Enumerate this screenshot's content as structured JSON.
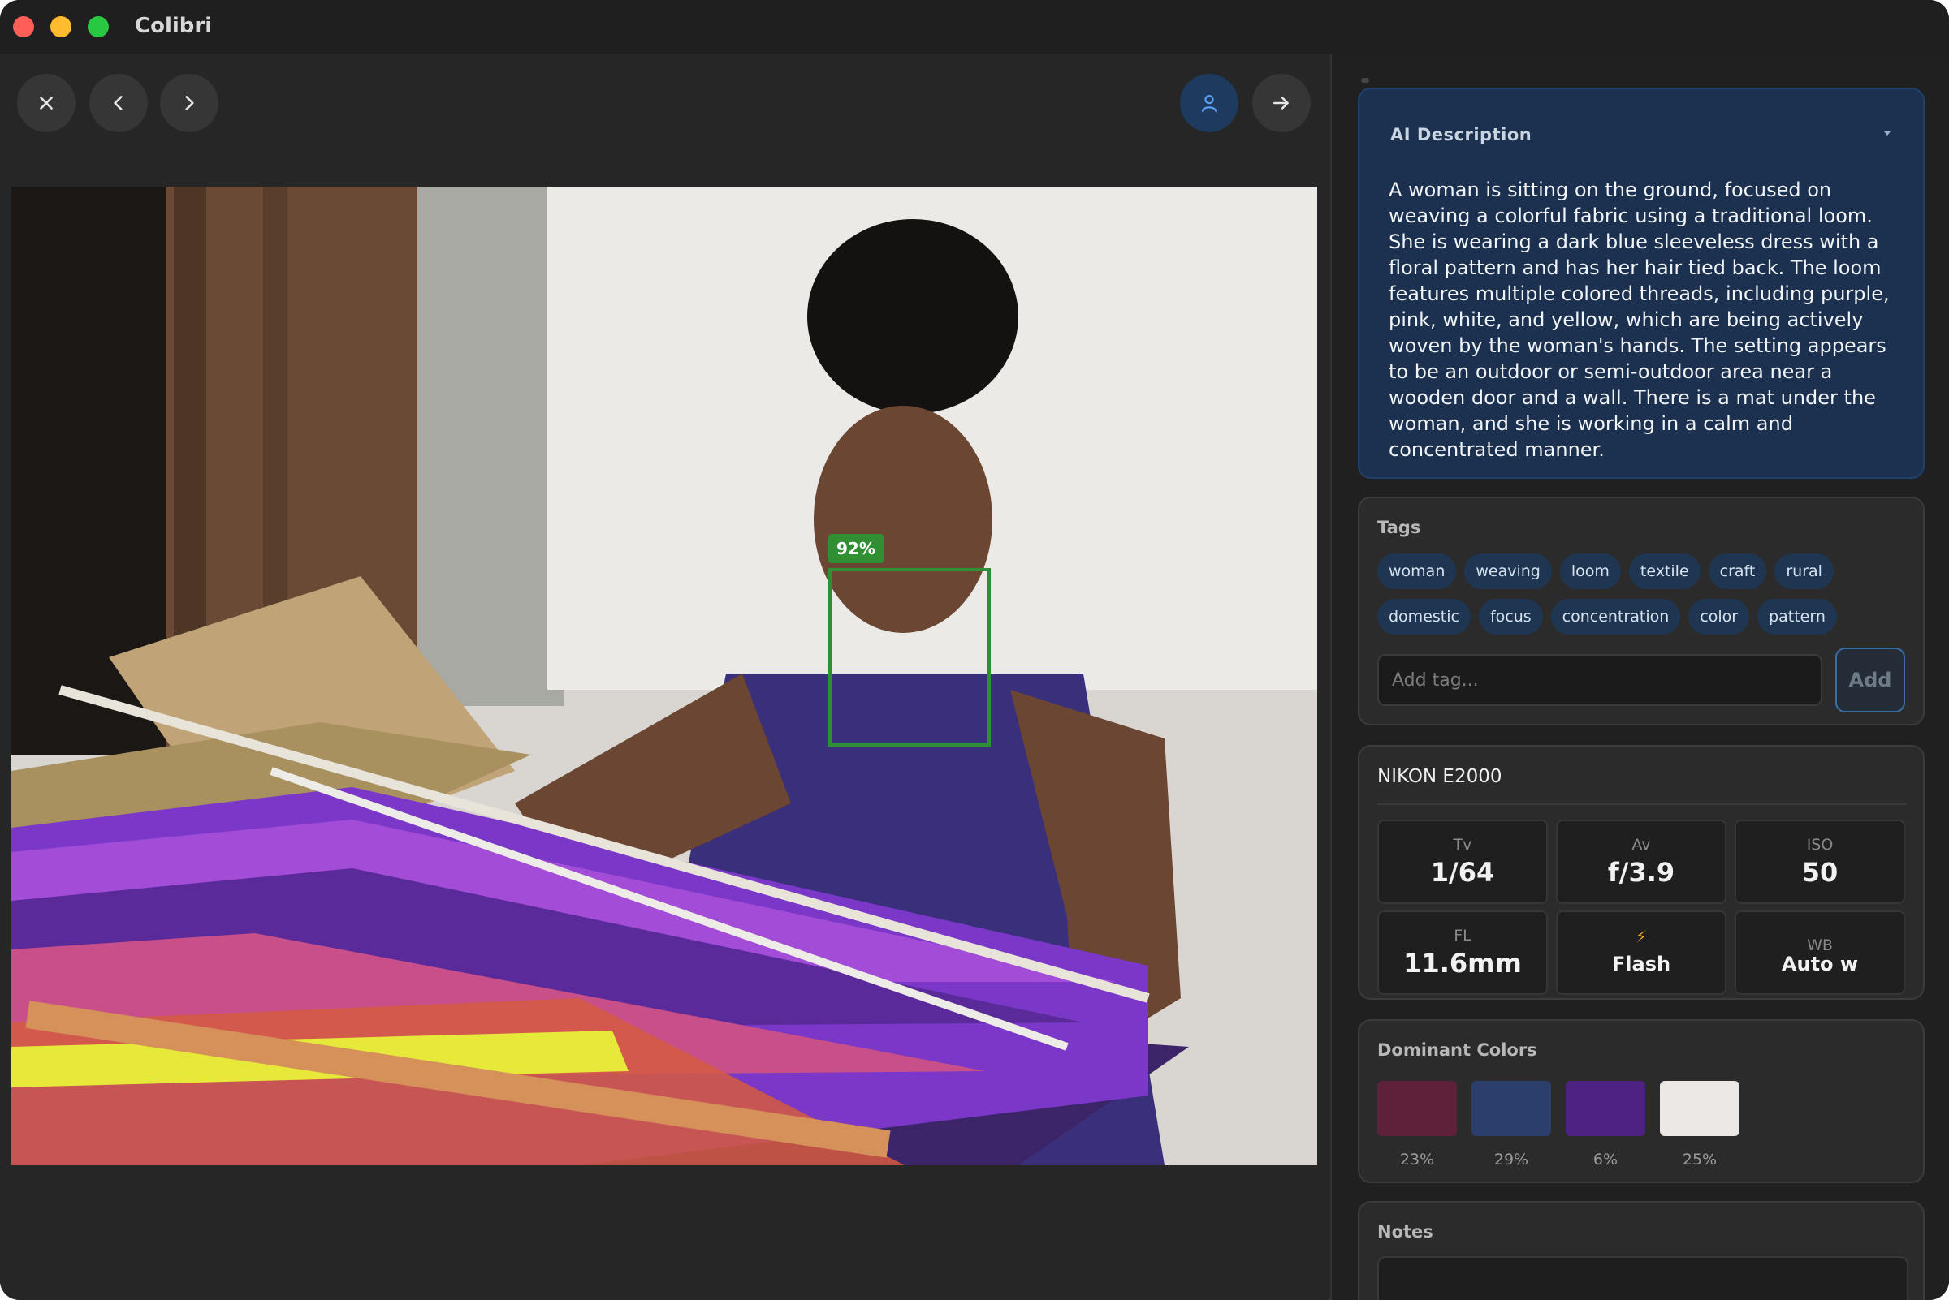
{
  "app": {
    "title": "Colibri"
  },
  "toolbar": {
    "close_icon": "close-icon",
    "prev_icon": "chevron-left-icon",
    "next_icon": "chevron-right-icon",
    "faces_icon": "person-icon",
    "share_icon": "arrow-right-icon"
  },
  "photo": {
    "face_confidence": "92%"
  },
  "ai_description": {
    "title": "AI Description",
    "text": "A woman is sitting on the ground, focused on weaving a colorful fabric using a traditional loom. She is wearing a dark blue sleeveless dress with a floral pattern and has her hair tied back. The loom features multiple colored threads, including purple, pink, white, and yellow, which are being actively woven by the woman's hands. The setting appears to be an outdoor or semi-outdoor area near a wooden door and a wall. There is a mat under the woman, and she is working in a calm and concentrated manner."
  },
  "tags": {
    "title": "Tags",
    "items": [
      "woman",
      "weaving",
      "loom",
      "textile",
      "craft",
      "rural",
      "domestic",
      "focus",
      "concentration",
      "color",
      "pattern"
    ],
    "input_placeholder": "Add tag...",
    "add_label": "Add"
  },
  "exif": {
    "camera": "NIKON E2000",
    "tv_label": "Tv",
    "tv_value": "1/64",
    "av_label": "Av",
    "av_value": "f/3.9",
    "iso_label": "ISO",
    "iso_value": "50",
    "fl_label": "FL",
    "fl_value": "11.6mm",
    "flash_glyph": "⚡",
    "flash_value": "Flash",
    "wb_label": "WB",
    "wb_value": "Auto w"
  },
  "dominant_colors": {
    "title": "Dominant Colors",
    "items": [
      {
        "color": "#5e2139",
        "percent": "23%"
      },
      {
        "color": "#2c3f6c",
        "percent": "29%"
      },
      {
        "color": "#4e2280",
        "percent": "6%"
      },
      {
        "color": "#ebe8e6",
        "percent": "25%"
      }
    ]
  },
  "notes": {
    "title": "Notes"
  }
}
